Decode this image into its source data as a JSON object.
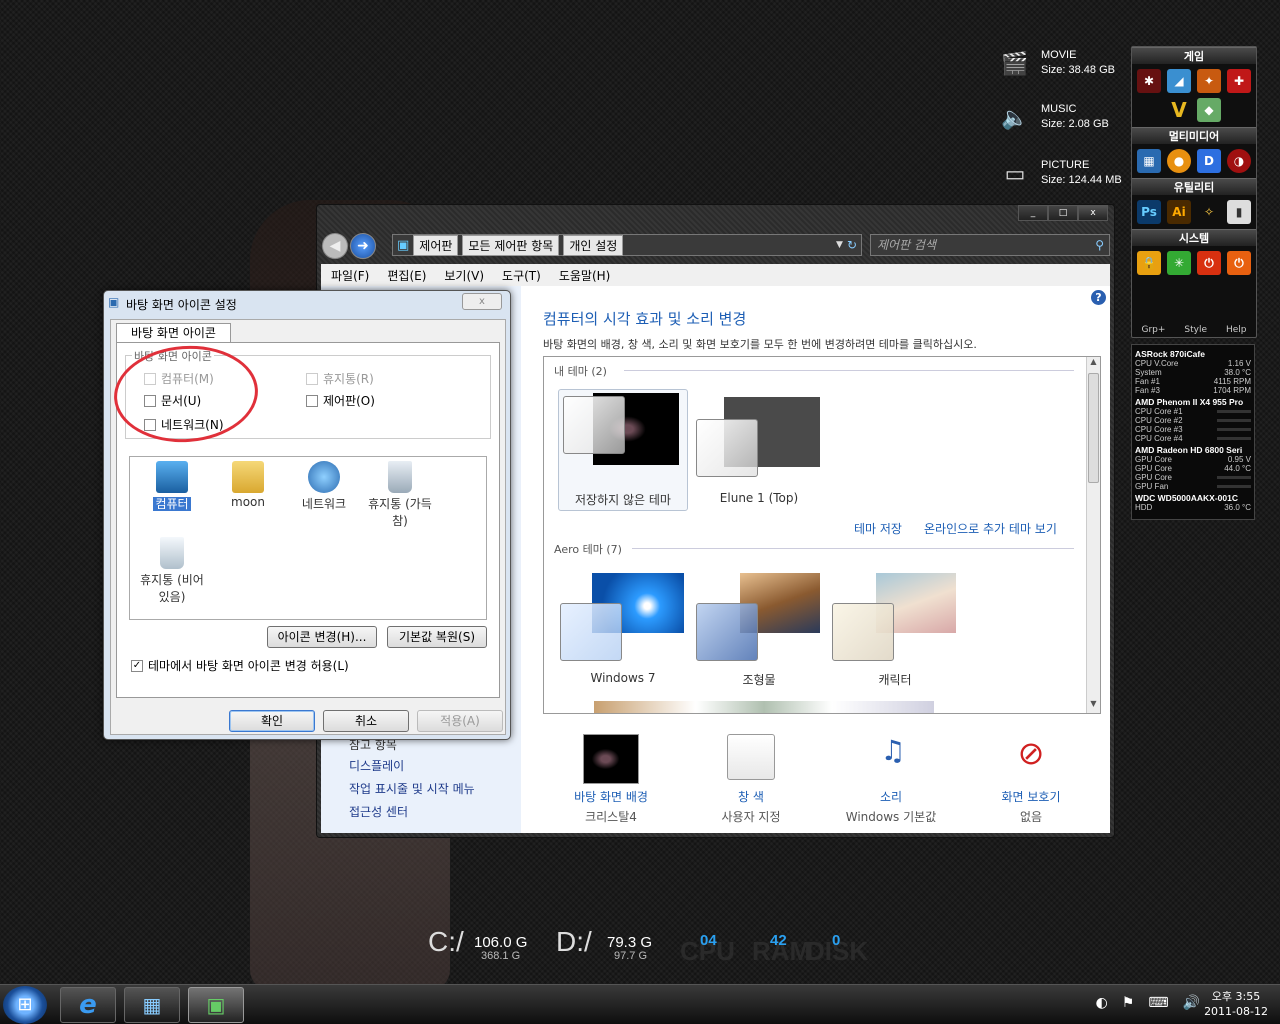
{
  "desktop": {
    "drives": [
      {
        "name": "MOVIE",
        "size": "Size: 38.48 GB",
        "icon": "film-icon"
      },
      {
        "name": "MUSIC",
        "size": "Size: 2.08 GB",
        "icon": "speaker-icon"
      },
      {
        "name": "PICTURE",
        "size": "Size: 124.44 MB",
        "icon": "picture-icon"
      }
    ],
    "stats": {
      "c_label": "C:/",
      "c_free": "106.0 G",
      "c_total": "368.1 G",
      "d_label": "D:/",
      "d_free": "79.3 G",
      "d_total": "97.7 G",
      "cpu_label": "CPU",
      "cpu_val": "04",
      "ram_label": "RAM",
      "ram_val": "42",
      "disk_label": "DISK",
      "disk_val": "0"
    }
  },
  "launcher": {
    "sections": [
      {
        "title": "게임"
      },
      {
        "title": "멀티미디어"
      },
      {
        "title": "유틸리티"
      },
      {
        "title": "시스템"
      }
    ],
    "footer": [
      "Grp+",
      "Style",
      "Help"
    ]
  },
  "sensor": {
    "board": "ASRock 870iCafe",
    "board_rows": [
      [
        "CPU V.Core",
        "1.16 V"
      ],
      [
        "System",
        "38.0 °C"
      ],
      [
        "Fan #1",
        "4115 RPM"
      ],
      [
        "Fan #3",
        "1704 RPM"
      ]
    ],
    "cpu": "AMD Phenom II X4 955 Pro",
    "cpu_rows": [
      "CPU Core #1",
      "CPU Core #2",
      "CPU Core #3",
      "CPU Core #4"
    ],
    "gpu": "AMD Radeon HD 6800 Seri",
    "gpu_rows": [
      [
        "GPU Core",
        "0.95 V"
      ],
      [
        "GPU Core",
        "44.0 °C"
      ],
      [
        "GPU Core",
        ""
      ],
      [
        "GPU Fan",
        ""
      ]
    ],
    "hdd": "WDC WD5000AAKX-001C",
    "hdd_rows": [
      [
        "HDD",
        "36.0 °C"
      ]
    ]
  },
  "control_panel": {
    "breadcrumbs": [
      "제어판",
      "모든 제어판 항목",
      "개인 설정"
    ],
    "search_placeholder": "제어판 검색",
    "menu": [
      "파일(F)",
      "편집(E)",
      "보기(V)",
      "도구(T)",
      "도움말(H)"
    ],
    "left_links": [
      "참고 항목",
      "디스플레이",
      "작업 표시줄 및 시작 메뉴",
      "접근성 센터"
    ],
    "heading": "컴퓨터의 시각 효과 및 소리 변경",
    "description": "바탕 화면의 배경, 창 색, 소리 및 화면 보호기를 모두 한 번에 변경하려면 테마를 클릭하십시오.",
    "my_themes_label": "내 테마 (2)",
    "my_themes": [
      {
        "name": "저장하지 않은 테마"
      },
      {
        "name": "Elune 1 (Top)"
      }
    ],
    "save_theme": "테마 저장",
    "online_themes": "온라인으로 추가 테마 보기",
    "aero_label": "Aero 테마 (7)",
    "aero_themes": [
      {
        "name": "Windows 7"
      },
      {
        "name": "조형물"
      },
      {
        "name": "캐릭터"
      }
    ],
    "bottom": [
      {
        "link": "바탕 화면 배경",
        "sub": "크리스탈4"
      },
      {
        "link": "창 색",
        "sub": "사용자 지정"
      },
      {
        "link": "소리",
        "sub": "Windows 기본값"
      },
      {
        "link": "화면 보호기",
        "sub": "없음"
      }
    ],
    "window_buttons": [
      "_",
      "□",
      "x"
    ]
  },
  "dialog": {
    "title": "바탕 화면 아이콘 설정",
    "close": "x",
    "tab": "바탕 화면 아이콘",
    "group_label": "바탕 화면 아이콘",
    "checkboxes": [
      {
        "label": "컴퓨터(M)",
        "checked": false,
        "disabled": true
      },
      {
        "label": "휴지통(R)",
        "checked": false,
        "disabled": true
      },
      {
        "label": "문서(U)",
        "checked": false,
        "disabled": false
      },
      {
        "label": "제어판(O)",
        "checked": false,
        "disabled": false
      },
      {
        "label": "네트워크(N)",
        "checked": false,
        "disabled": false
      }
    ],
    "icons": [
      {
        "label": "컴퓨터"
      },
      {
        "label": "moon"
      },
      {
        "label": "네트워크"
      },
      {
        "label": "휴지통 (가득 참)"
      },
      {
        "label": "휴지통 (비어 있음)"
      }
    ],
    "change_icon": "아이콘 변경(H)...",
    "restore_default": "기본값 복원(S)",
    "allow_theme": "테마에서 바탕 화면 아이콘 변경 허용(L)",
    "ok": "확인",
    "cancel": "취소",
    "apply": "적용(A)"
  },
  "taskbar": {
    "clock_time": "오후 3:55",
    "clock_date": "2011-08-12"
  }
}
